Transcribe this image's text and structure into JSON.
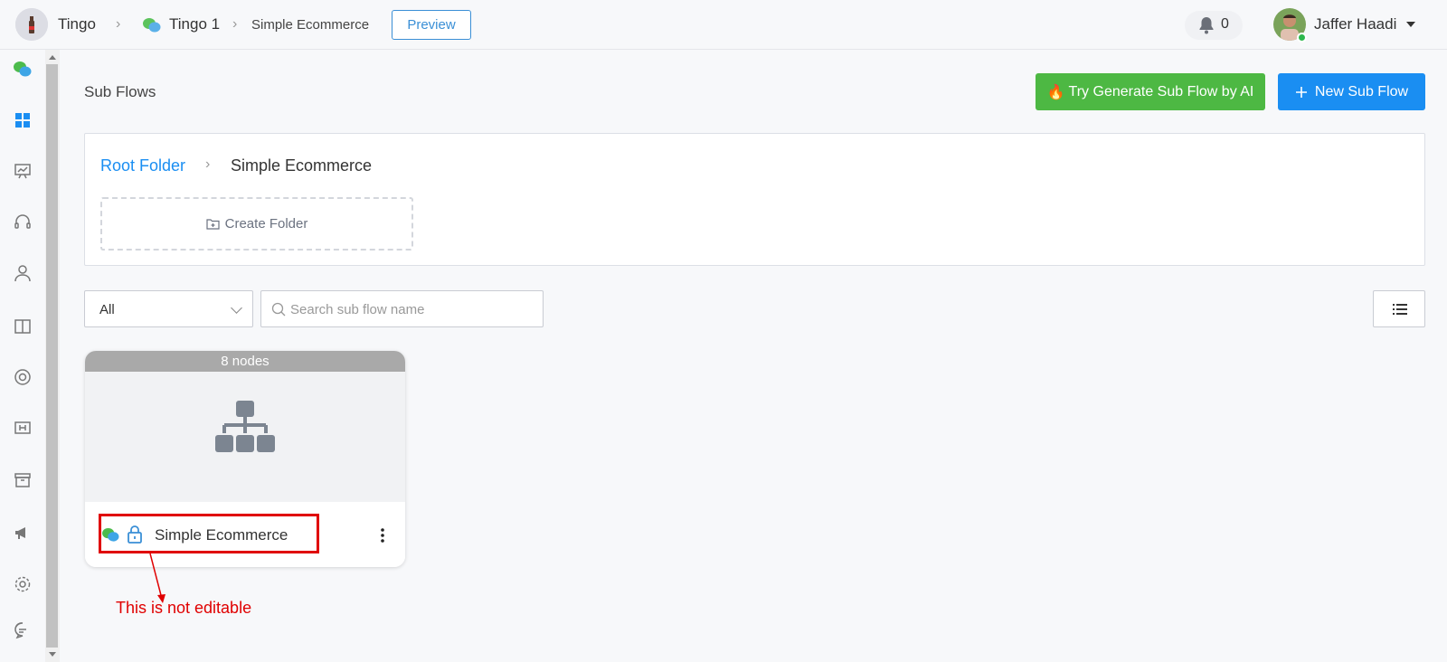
{
  "topbar": {
    "workspace": "Tingo",
    "bot": "Tingo 1",
    "flow": "Simple Ecommerce",
    "preview_label": "Preview",
    "notification_count": "0",
    "user_name": "Jaffer Haadi"
  },
  "sidebar": {
    "items": [
      "chat-bubbles-icon",
      "dashboard-icon",
      "presentation-icon",
      "headset-icon",
      "user-icon",
      "book-icon",
      "lifebuoy-icon",
      "input-icon",
      "archive-icon",
      "megaphone-icon",
      "gear-icon",
      "comment-icon"
    ]
  },
  "main": {
    "page_title": "Sub Flows",
    "ai_button": "Try Generate Sub Flow by AI",
    "ai_icon": "🔥",
    "new_button": "New Sub Flow",
    "breadcrumb_root": "Root Folder",
    "breadcrumb_current": "Simple Ecommerce",
    "create_folder": "Create Folder",
    "filter_value": "All",
    "search_placeholder": "Search sub flow name"
  },
  "card": {
    "badge": "8 nodes",
    "name": "Simple Ecommerce"
  },
  "annotation": {
    "text": "This is not editable"
  },
  "colors": {
    "accent_blue": "#1a8ef2",
    "ai_green": "#4db843",
    "annotation_red": "#e00000"
  }
}
